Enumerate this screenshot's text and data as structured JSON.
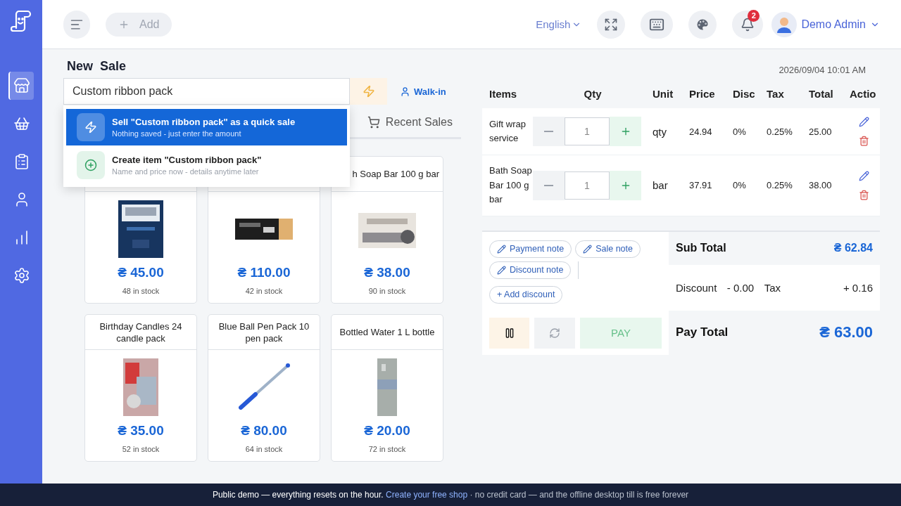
{
  "sidebar": {
    "items": [
      {
        "kind": "store",
        "selected": true
      },
      {
        "kind": "cart",
        "selected": false
      },
      {
        "kind": "clipboard",
        "selected": false
      },
      {
        "kind": "user",
        "selected": false
      },
      {
        "kind": "chart",
        "selected": false
      },
      {
        "kind": "settings",
        "selected": false
      }
    ]
  },
  "topbar": {
    "add_button": "Add",
    "language": "English",
    "notifications": "2",
    "user": "Demo Admin"
  },
  "sale": {
    "title": "New  Sale",
    "datetime": "2026/09/04 10:01 AM",
    "search": {
      "value": "Custom ribbon pack"
    },
    "customer": "Walk-in",
    "suggestions": [
      {
        "kind": "quick",
        "title": "Sell \"Custom ribbon pack\" as a quick sale",
        "subtitle": "Nothing saved - just enter the amount",
        "selected": true
      },
      {
        "kind": "create",
        "title": "Create item \"Custom ribbon pack\"",
        "subtitle": "Name and price now - details anytime later",
        "selected": false
      }
    ],
    "tabs": [
      {
        "label": "Recent Sales",
        "selected": false
      }
    ],
    "products": [
      {
        "kind": "picture",
        "price": "₴ 45.00",
        "stock": "48 in stock"
      },
      {
        "kind": "picture",
        "price": "₴ 110.00",
        "stock": "42 in stock"
      },
      {
        "kind": "picture",
        "name": "h Soap Bar 100 g bar",
        "price": "₴ 38.00",
        "stock": "90 in stock"
      },
      {
        "kind": "picture",
        "name": "Birthday Candles 24 candle pack",
        "price": "₴ 35.00",
        "stock": "52 in stock"
      },
      {
        "kind": "picture",
        "name": "Blue Ball Pen Pack 10 pen pack",
        "price": "₴ 80.00",
        "stock": "64 in stock"
      },
      {
        "kind": "picture",
        "name": "Bottled Water 1 L bottle",
        "price": "₴ 20.00",
        "stock": "72 in stock"
      }
    ]
  },
  "cart": {
    "columns": [
      "Items",
      "Qty",
      "Unit",
      "Price",
      "Disc",
      "Tax",
      "Total",
      "Actio"
    ],
    "rows": [
      {
        "item": "Gift wrap service",
        "qty": "1",
        "unit": "qty",
        "price": "24.94",
        "disc": "0%",
        "tax": "0.25%",
        "total": "25.00"
      },
      {
        "item": "Bath Soap Bar 100 g bar",
        "qty": "1",
        "unit": "bar",
        "price": "37.91",
        "disc": "0%",
        "tax": "0.25%",
        "total": "38.00"
      }
    ]
  },
  "notes": [
    {
      "kind": "note",
      "label": "Payment note"
    },
    {
      "kind": "note",
      "label": "Sale note"
    },
    {
      "kind": "note",
      "label": "Discount note"
    },
    {
      "kind": "add",
      "label": "+ Add discount"
    }
  ],
  "summary": {
    "sub_total_label": "Sub Total",
    "sub_total": "₴ 62.84",
    "discount_label": "Discount",
    "discount": "- 0.00",
    "tax_label": "Tax",
    "tax": "+ 0.16",
    "pay_total_label": "Pay Total",
    "pay_total": "₴ 63.00"
  },
  "pay_button": "PAY",
  "footer": {
    "text": "Public demo — everything resets on the hour.",
    "link": "Create your free shop",
    "rest": "· no credit card — and the offline desktop till is free forever"
  }
}
